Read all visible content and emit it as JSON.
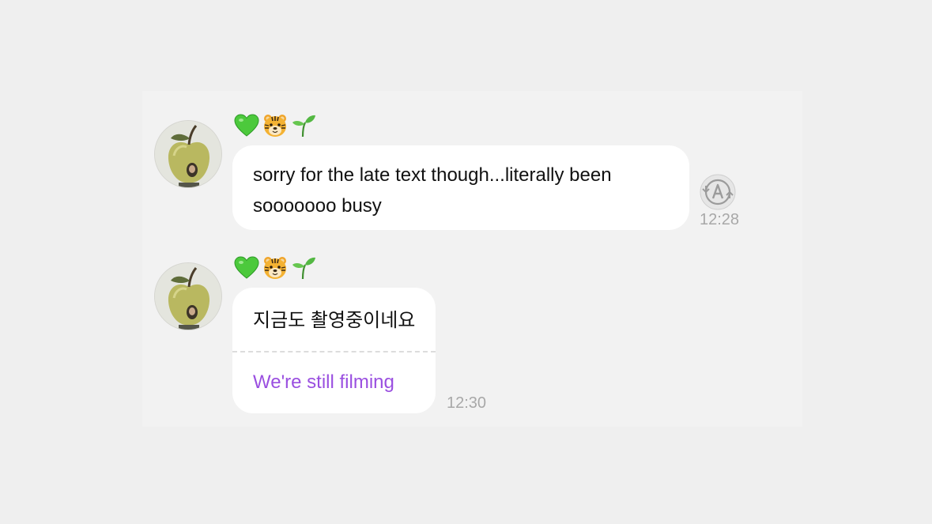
{
  "messages": [
    {
      "sender_emojis": [
        "green-heart",
        "tiger-face",
        "seedling"
      ],
      "text": "sorry for the late text though...literally been sooooooo busy",
      "time": "12:28",
      "translate_icon": "translate-a-icon"
    },
    {
      "sender_emojis": [
        "green-heart",
        "tiger-face",
        "seedling"
      ],
      "text": "지금도 촬영중이네요",
      "translation": "We're still filming",
      "time": "12:30"
    }
  ],
  "colors": {
    "background": "#efefef",
    "bubble": "#ffffff",
    "translation_text": "#9a4fe0",
    "timestamp": "#a8a8a8"
  }
}
